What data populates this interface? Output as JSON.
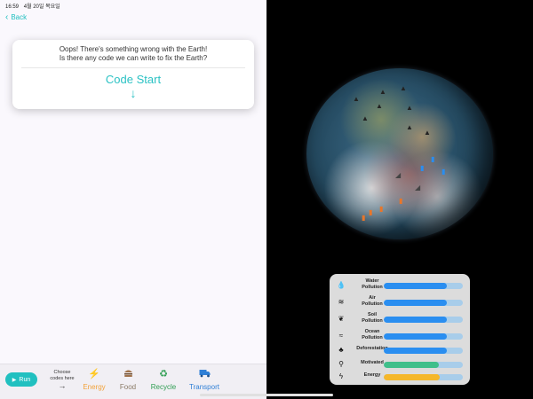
{
  "status": {
    "time": "16:59",
    "date": "4월 20일 목요일"
  },
  "nav": {
    "back_label": "Back"
  },
  "prompt_card": {
    "line1": "Oops! There's something wrong with the Earth!",
    "line2": "Is there any code we can write to fix the Earth?",
    "start_label": "Code Start"
  },
  "toolbar": {
    "run_label": "Run",
    "choose_line1": "Choose",
    "choose_line2": "codes here",
    "categories": [
      {
        "label": "Energy",
        "icon": "lightning-icon",
        "color": "#f2a23a"
      },
      {
        "label": "Food",
        "icon": "burger-icon",
        "color": "#8a7a66"
      },
      {
        "label": "Recycle",
        "icon": "recycle-icon",
        "color": "#2f9e52"
      },
      {
        "label": "Transport",
        "icon": "truck-icon",
        "color": "#2f7fd6"
      }
    ]
  },
  "stats": [
    {
      "line1": "Water",
      "line2": "Pollution",
      "icon": "water-drop-icon",
      "level": 0.8,
      "color": "#2a8ef0"
    },
    {
      "line1": "Air",
      "line2": "Pollution",
      "icon": "wind-icon",
      "level": 0.8,
      "color": "#2a8ef0"
    },
    {
      "line1": "Soil",
      "line2": "Pollution",
      "icon": "leaf-icon",
      "level": 0.8,
      "color": "#2a8ef0"
    },
    {
      "line1": "Ocean",
      "line2": "Pollution",
      "icon": "waves-icon",
      "level": 0.8,
      "color": "#2a8ef0"
    },
    {
      "line1": "Deforestation",
      "line2": "",
      "icon": "tree-icon",
      "level": 0.8,
      "color": "#2a8ef0"
    },
    {
      "line1": "Motivated",
      "line2": "",
      "icon": "person-icon",
      "level": 0.7,
      "color": "#3fbf8a"
    },
    {
      "line1": "Energy",
      "line2": "",
      "icon": "lightning-icon",
      "level": 0.71,
      "color": "#f5b72a"
    }
  ]
}
